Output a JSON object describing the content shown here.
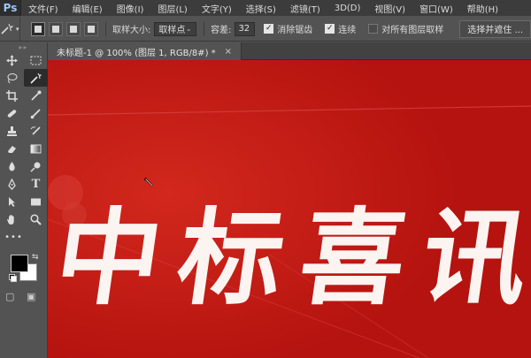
{
  "app": {
    "logo": "Ps"
  },
  "menu": [
    "文件(F)",
    "编辑(E)",
    "图像(I)",
    "图层(L)",
    "文字(Y)",
    "选择(S)",
    "滤镜(T)",
    "3D(D)",
    "视图(V)",
    "窗口(W)",
    "帮助(H)"
  ],
  "options": {
    "sample_size_label": "取样大小:",
    "sample_size_value": "取样点",
    "tolerance_label": "容差:",
    "tolerance_value": "32",
    "antialias_label": "消除锯齿",
    "contiguous_label": "连续",
    "sample_all_layers_label": "对所有图层取样",
    "select_mask_label": "选择并遮住 ..."
  },
  "document": {
    "tab_title": "未标题-1 @ 100% (图层 1, RGB/8#) *",
    "close_glyph": "×",
    "calligraphy_text": "中标喜讯",
    "background_color": "#c41a15"
  },
  "toolbar": {
    "grip": "▸▸",
    "more": "•••",
    "help_glyph": "▢",
    "screen_mode_glyph": "▣",
    "foreground_color": "#000000",
    "background_color": "#ffffff"
  },
  "icons": {
    "magic_wand": "magic-wand-icon",
    "chevron": "chevron-down-icon"
  }
}
